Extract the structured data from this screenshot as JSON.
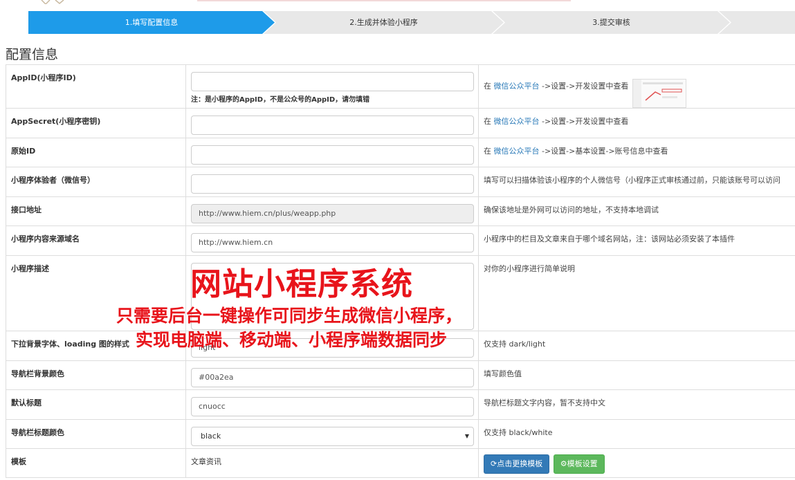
{
  "steps": [
    {
      "label": "1.填写配置信息",
      "active": true
    },
    {
      "label": "2.生成并体验小程序",
      "active": false
    },
    {
      "label": "3.提交审核",
      "active": false
    },
    {
      "label": "",
      "active": false
    }
  ],
  "section_title": "配置信息",
  "rows": {
    "appid": {
      "label": "AppID(小程序ID)",
      "value": "",
      "note": "注：是小程序的AppID，不是公众号的AppID，请勿填错",
      "help_prefix": "在 ",
      "help_link": "微信公众平台",
      "help_suffix": " ->设置->开发设置中查看"
    },
    "appsecret": {
      "label": "AppSecret(小程序密钥)",
      "value": "",
      "help_prefix": "在 ",
      "help_link": "微信公众平台",
      "help_suffix": " ->设置->开发设置中查看"
    },
    "original_id": {
      "label": "原始ID",
      "value": "",
      "help_prefix": "在 ",
      "help_link": "微信公众平台",
      "help_suffix": " ->设置->基本设置->账号信息中查看"
    },
    "tester": {
      "label": "小程序体验者（微信号）",
      "value": "",
      "help": "填写可以扫描体验该小程序的个人微信号（小程序正式审核通过前，只能该账号可以访问"
    },
    "api_url": {
      "label": "接口地址",
      "value": "http://www.hiem.cn/plus/weapp.php",
      "help": "确保该地址是外网可以访问的地址，不支持本地调试"
    },
    "content_domain": {
      "label": "小程序内容来源域名",
      "value": "http://www.hiem.cn",
      "help": "小程序中的栏目及文章来自于哪个域名网站，注：该网站必须安装了本插件"
    },
    "description": {
      "label": "小程序描述",
      "value": "",
      "help": "对你的小程序进行简单说明"
    },
    "loading_style": {
      "label": "下拉背景字体、loading 图的样式",
      "value": "light",
      "help": "仅支持 dark/light"
    },
    "nav_bg_color": {
      "label": "导航栏背景颜色",
      "value": "#00a2ea",
      "help": "填写颜色值"
    },
    "default_title": {
      "label": "默认标题",
      "value": "cnuocc",
      "help": "导航栏标题文字内容，暂不支持中文"
    },
    "nav_title_color": {
      "label": "导航栏标题颜色",
      "value": "black",
      "help": "仅支持 black/white"
    },
    "template": {
      "label": "模板",
      "value": "文章资讯",
      "btn_change": "点击更换模板",
      "btn_settings": "模板设置"
    }
  },
  "overlay": {
    "title": "网站小程序系统",
    "line1": "只需要后台一键操作可同步生成微信小程序，",
    "line2": "实现电脑端、移动端、小程序端数据同步"
  },
  "colors": {
    "accent": "#1e9be9",
    "overlay_red": "#e8141b",
    "link": "#2a7ab8"
  }
}
